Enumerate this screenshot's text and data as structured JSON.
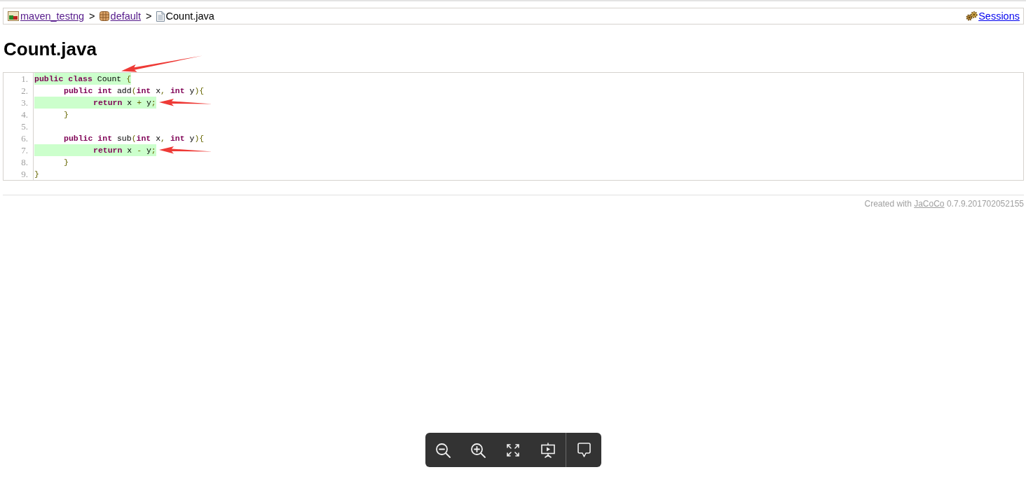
{
  "breadcrumb": {
    "items": [
      {
        "label": "maven_testng",
        "kind": "report",
        "link": true,
        "visited": true,
        "separator": ">"
      },
      {
        "label": "default",
        "kind": "package",
        "link": true,
        "visited": true,
        "separator": ">"
      },
      {
        "label": "Count.java",
        "kind": "file",
        "link": false,
        "visited": false
      }
    ],
    "sessions": {
      "label": "Sessions",
      "visited": false
    }
  },
  "title": "Count.java",
  "source": {
    "lines": [
      {
        "number": "1.",
        "covered": true,
        "arrow": {
          "kind": "diagonal"
        },
        "tokens": [
          {
            "kind": "keyword",
            "text": "public"
          },
          {
            "kind": "keyword",
            "text": " class"
          },
          {
            "kind": "plain",
            "text": " Count "
          },
          {
            "kind": "punctuation",
            "text": "{"
          }
        ]
      },
      {
        "number": "2.",
        "covered": false,
        "tokens": [
          {
            "kind": "keyword",
            "text": "\tpublic"
          },
          {
            "kind": "keyword",
            "text": " int"
          },
          {
            "kind": "plain",
            "text": " add"
          },
          {
            "kind": "punctuation",
            "text": "("
          },
          {
            "kind": "keyword",
            "text": "int"
          },
          {
            "kind": "plain",
            "text": " x"
          },
          {
            "kind": "punctuation",
            "text": ","
          },
          {
            "kind": "keyword",
            "text": " int"
          },
          {
            "kind": "plain",
            "text": " y"
          },
          {
            "kind": "punctuation",
            "text": "){"
          }
        ]
      },
      {
        "number": "3.",
        "covered": true,
        "arrow": {
          "kind": "horizontal"
        },
        "tokens": [
          {
            "kind": "keyword",
            "text": "\t\treturn"
          },
          {
            "kind": "plain",
            "text": " x "
          },
          {
            "kind": "punctuation",
            "text": "+"
          },
          {
            "kind": "plain",
            "text": " y"
          },
          {
            "kind": "punctuation",
            "text": ";"
          }
        ]
      },
      {
        "number": "4.",
        "covered": false,
        "tokens": [
          {
            "kind": "punctuation",
            "text": "\t}"
          }
        ]
      },
      {
        "number": "5.",
        "covered": false
      },
      {
        "number": "6.",
        "covered": false,
        "tokens": [
          {
            "kind": "keyword",
            "text": "\tpublic"
          },
          {
            "kind": "keyword",
            "text": " int"
          },
          {
            "kind": "plain",
            "text": " sub"
          },
          {
            "kind": "punctuation",
            "text": "("
          },
          {
            "kind": "keyword",
            "text": "int"
          },
          {
            "kind": "plain",
            "text": " x"
          },
          {
            "kind": "punctuation",
            "text": ","
          },
          {
            "kind": "keyword",
            "text": " int"
          },
          {
            "kind": "plain",
            "text": " y"
          },
          {
            "kind": "punctuation",
            "text": "){"
          }
        ]
      },
      {
        "number": "7.",
        "covered": true,
        "arrow": {
          "kind": "horizontal"
        },
        "tokens": [
          {
            "kind": "keyword",
            "text": "\t\treturn"
          },
          {
            "kind": "plain",
            "text": " x "
          },
          {
            "kind": "punctuation",
            "text": "-"
          },
          {
            "kind": "plain",
            "text": " y"
          },
          {
            "kind": "punctuation",
            "text": ";"
          }
        ]
      },
      {
        "number": "8.",
        "covered": false,
        "tokens": [
          {
            "kind": "punctuation",
            "text": "\t}"
          }
        ]
      },
      {
        "number": "9.",
        "covered": false,
        "tokens": [
          {
            "kind": "punctuation",
            "text": "}"
          }
        ]
      }
    ]
  },
  "footer": {
    "text_before": "Created with",
    "link": "JaCoCo",
    "text_after": "0.7.9.201702052155"
  },
  "viewer_toolbar": {
    "buttons": [
      {
        "kind": "zoom-out",
        "separated": false
      },
      {
        "kind": "zoom-in",
        "separated": false
      },
      {
        "kind": "fullscreen",
        "separated": false
      },
      {
        "kind": "slideshow",
        "separated": false
      },
      {
        "kind": "comment",
        "separated": true
      }
    ]
  }
}
